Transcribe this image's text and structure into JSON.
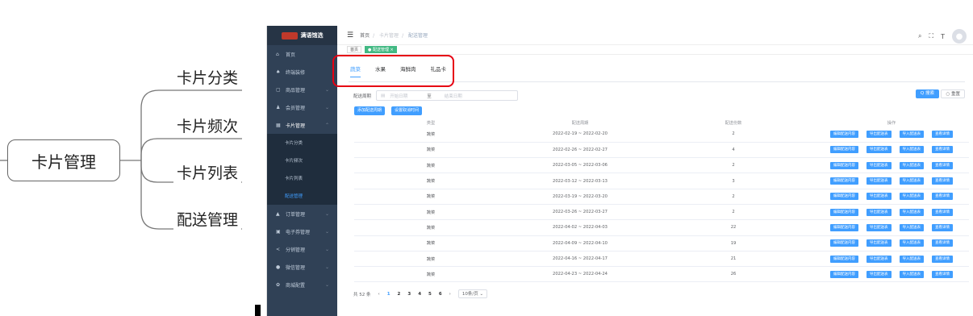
{
  "mindmap": {
    "root": "卡片管理",
    "children": [
      "卡片分类",
      "卡片频次",
      "卡片列表",
      "配送管理"
    ]
  },
  "logo": "满语馆选",
  "sidebar": [
    {
      "label": "首页",
      "icon": "home-icon",
      "glyph": "⌂"
    },
    {
      "label": "终端装修",
      "icon": "shirt-icon",
      "glyph": "♠"
    },
    {
      "label": "商品管理",
      "icon": "box-icon",
      "glyph": "▢",
      "arrow": "⌄"
    },
    {
      "label": "会员管理",
      "icon": "users-icon",
      "glyph": "♟",
      "arrow": "⌄"
    },
    {
      "label": "卡片管理",
      "icon": "card-icon",
      "glyph": "▦",
      "arrow": "⌃",
      "open": true,
      "children": [
        "卡片分类",
        "卡片频次",
        "卡片列表",
        "配送管理"
      ]
    },
    {
      "label": "订单管理",
      "icon": "lock-icon",
      "glyph": "▲",
      "arrow": "⌄"
    },
    {
      "label": "电子券管理",
      "icon": "ticket-icon",
      "glyph": "▣",
      "arrow": "⌄"
    },
    {
      "label": "分销管理",
      "icon": "share-icon",
      "glyph": "<",
      "arrow": "⌄"
    },
    {
      "label": "微信管理",
      "icon": "wechat-icon",
      "glyph": "●",
      "arrow": "⌄"
    },
    {
      "label": "商城配置",
      "icon": "gear-icon",
      "glyph": "✿",
      "arrow": "⌄"
    }
  ],
  "breadcrumb": [
    "首页",
    "卡片管理",
    "配送管理"
  ],
  "tags": [
    "首页",
    "● 配送管理 ×"
  ],
  "tabs": [
    "蔬菜",
    "水果",
    "海鲜肉",
    "礼品卡"
  ],
  "filter": {
    "label": "配送周期",
    "start": "开始日期",
    "to": "至",
    "end": "结束日期"
  },
  "search_btn": "Q 搜索",
  "reset_btn": "○ 重置",
  "add_btn": "添加配送周期",
  "set_btn": "设置取消时间",
  "columns": [
    "类型",
    "配送周期",
    "配送份数",
    "操作"
  ],
  "row_actions": [
    "编辑配送内容",
    "导出配送表",
    "导入配送表",
    "查看详情"
  ],
  "rows": [
    [
      "蔬菜",
      "2022-02-19 ~ 2022-02-20",
      "2"
    ],
    [
      "蔬菜",
      "2022-02-26 ~ 2022-02-27",
      "4"
    ],
    [
      "蔬菜",
      "2022-03-05 ~ 2022-03-06",
      "2"
    ],
    [
      "蔬菜",
      "2022-03-12 ~ 2022-03-13",
      "3"
    ],
    [
      "蔬菜",
      "2022-03-19 ~ 2022-03-20",
      "2"
    ],
    [
      "蔬菜",
      "2022-03-26 ~ 2022-03-27",
      "2"
    ],
    [
      "蔬菜",
      "2022-04-02 ~ 2022-04-03",
      "22"
    ],
    [
      "蔬菜",
      "2022-04-09 ~ 2022-04-10",
      "19"
    ],
    [
      "蔬菜",
      "2022-04-16 ~ 2022-04-17",
      "21"
    ],
    [
      "蔬菜",
      "2022-04-23 ~ 2022-04-24",
      "26"
    ]
  ],
  "pager": {
    "total": "共 52 条",
    "pages": [
      "1",
      "2",
      "3",
      "4",
      "5",
      "6"
    ],
    "size": "10条/页"
  },
  "colors": {
    "primary": "#409eff",
    "sidebar": "#304156",
    "highlight": "#e60012"
  }
}
